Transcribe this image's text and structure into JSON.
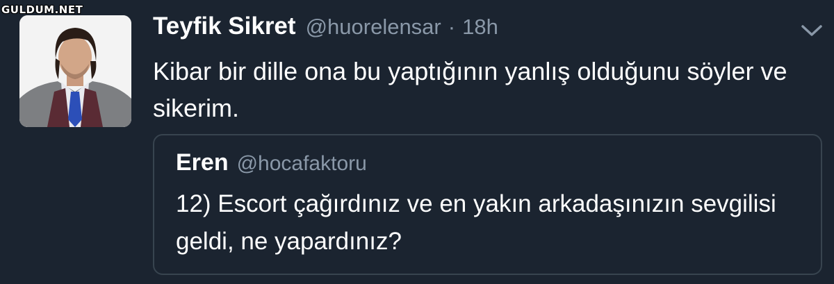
{
  "watermark": "GULDUM.NET",
  "tweet": {
    "author_name": "Teyfik Sikret",
    "author_handle": "@huorelensar",
    "separator": "·",
    "timestamp": "18h",
    "text": "Kibar bir dille ona bu yaptığının yanlış olduğunu söyler ve sikerim.",
    "menu_icon": "chevron-down-icon",
    "avatar_icon": "user-avatar"
  },
  "quoted_tweet": {
    "author_name": "Eren",
    "author_handle": "@hocafaktoru",
    "text": "12) Escort çağırdınız ve en yakın arkadaşınızın sevgilisi geldi, ne yapardınız?"
  },
  "colors": {
    "background": "#1b2430",
    "primary_text": "#ffffff",
    "secondary_text": "#8a98a8",
    "quote_border": "#38444f"
  }
}
